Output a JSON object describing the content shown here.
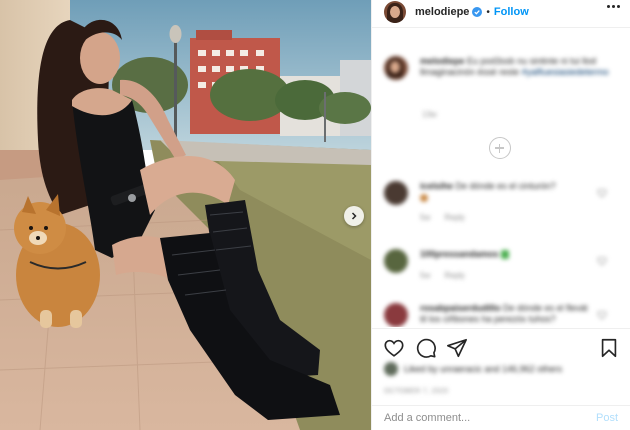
{
  "post": {
    "username": "melodiepe",
    "separator": "•",
    "follow_label": "Follow"
  },
  "caption": {
    "username": "melodiepe",
    "text": "Eu pod3ssb nu sintinte ni tui llod llmaginacinón éssé reste",
    "hashtag": "#yalfiuesiasiedetermo",
    "time": "13w"
  },
  "comments": [
    {
      "username": "icelsihe",
      "text": "De dónde es el cinturón?",
      "likes": "5w",
      "reply": "Reply",
      "avatar_color": "#4a3a32"
    },
    {
      "username": "100pressandamos",
      "text": "",
      "likes": "5w",
      "reply": "Reply",
      "avatar_color": "#58663f"
    },
    {
      "username": "rosabpaiserdudillo",
      "text": "De dónde es el flevát til los ciñbones ha perezós tuhos?",
      "likes": "",
      "reply": "",
      "avatar_color": "#8a3a3e"
    }
  ],
  "likes": {
    "text": "Liked by unraeracic and 146,962 others"
  },
  "date": "OCTOBER 7, 2020",
  "add_comment": {
    "placeholder": "Add a comment...",
    "post_label": "Post"
  },
  "icons": {
    "verified": "verified-badge-icon",
    "more": "more-options-icon",
    "like": "heart-icon",
    "comment": "comment-bubble-icon",
    "share": "paper-plane-icon",
    "save": "bookmark-icon",
    "next": "chevron-right-icon",
    "load_more": "plus-circle-icon"
  },
  "colors": {
    "accent": "#0095f6",
    "muted": "#8e8e8e",
    "text": "#262626",
    "post_disabled": "#b2dffc"
  }
}
